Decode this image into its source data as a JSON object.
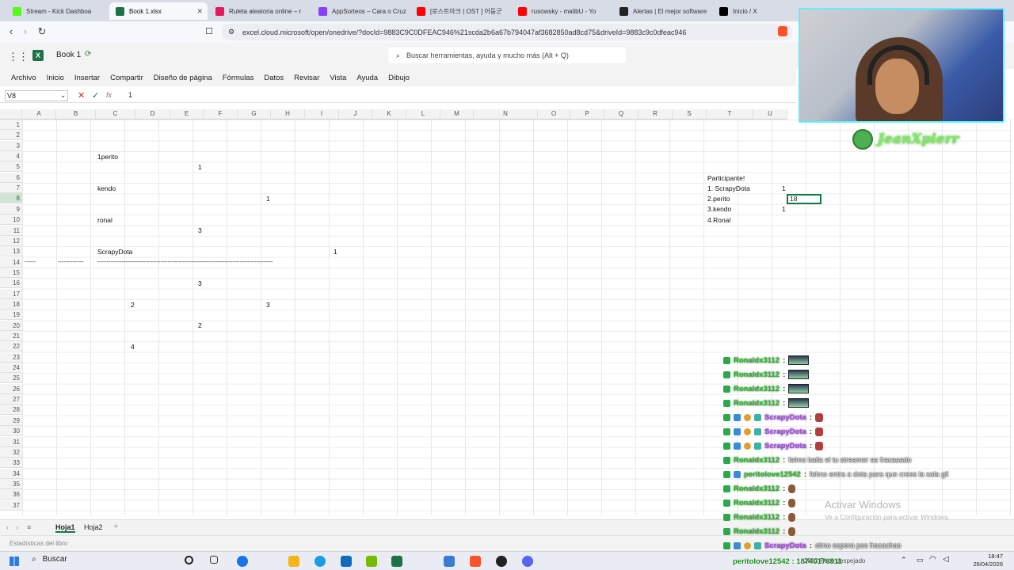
{
  "browser": {
    "tabs": [
      {
        "label": "Stream - Kick Dashboa",
        "color": "#53fc18"
      },
      {
        "label": "Book 1.xlsx",
        "color": "#1e7145",
        "active": true
      },
      {
        "label": "Ruleta aleatoria online – r",
        "color": "#e5195b"
      },
      {
        "label": "AppSorteos – Cara o Cruz",
        "color": "#8a3ffc"
      },
      {
        "label": "[로스트아크 | OST ] 어둠군",
        "color": "#ff0000"
      },
      {
        "label": "rusowsky - malibU - Yo",
        "color": "#ff0000"
      },
      {
        "label": "Alertas | El mejor software",
        "color": "#222222"
      },
      {
        "label": "Inicio / X",
        "color": "#000000"
      }
    ],
    "close_label": "✕",
    "url": "excel.cloud.microsoft/open/onedrive/?docId=9883C9C0DFEAC946%21scda2b6a67b794047af3682850ad8cd75&driveId=9883c9c0dfeac946"
  },
  "excel": {
    "book_title": "Book 1",
    "search_placeholder": "Buscar herramientas, ayuda y mucho más (Alt + Q)",
    "ribbon_tabs": [
      "Archivo",
      "Inicio",
      "Insertar",
      "Compartir",
      "Diseño de página",
      "Fórmulas",
      "Datos",
      "Revisar",
      "Vista",
      "Ayuda",
      "Dibujo"
    ],
    "name_box": "V8",
    "formula_value": "1",
    "fx": "fx",
    "columns": [
      "A",
      "B",
      "C",
      "D",
      "E",
      "F",
      "G",
      "H",
      "I",
      "J",
      "K",
      "L",
      "M",
      "N",
      "O",
      "P",
      "Q",
      "R",
      "S",
      "T",
      "U"
    ],
    "rows": [
      "1",
      "2",
      "3",
      "4",
      "5",
      "6",
      "7",
      "8",
      "9",
      "10",
      "11",
      "12",
      "13",
      "14",
      "15",
      "16",
      "17",
      "18",
      "19",
      "20",
      "21",
      "22",
      "23",
      "24",
      "25",
      "26",
      "27",
      "28",
      "29",
      "30",
      "31",
      "32",
      "33",
      "34",
      "35",
      "36",
      "37"
    ],
    "cells": {
      "c4": "1perito",
      "e5": "1",
      "c7": "kendo",
      "g8": "1",
      "c10": "ronal",
      "e11": "3",
      "c13": "ScrapyDota",
      "i13": "1",
      "a14": "------",
      "b14": "--------------",
      "c14": "-----------------------------------------------------------------------------------------------",
      "e16": "3",
      "d18": "2",
      "g18": "3",
      "e20": "2",
      "d22": "4",
      "t6": "Participante!",
      "t7": "1. ScrapyDota",
      "u7": "1",
      "t8": "2.perito",
      "t9": "3.kendo",
      "u9": "1",
      "t10": "4.Ronal"
    },
    "editing_value": "18",
    "sheets": [
      "Hoja1",
      "Hoja2"
    ],
    "add_sheet": "+",
    "status": "Estadísticas del libro"
  },
  "stream": {
    "streamer_name": "JeanXpierr",
    "chat": [
      {
        "user": "Ronaldx3112",
        "type": "emote"
      },
      {
        "user": "Ronaldx3112",
        "type": "emote"
      },
      {
        "user": "Ronaldx3112",
        "type": "emote"
      },
      {
        "user": "Ronaldx3112",
        "type": "emote"
      },
      {
        "user": "ScrapyDota",
        "type": "small",
        "purple": true
      },
      {
        "user": "ScrapyDota",
        "type": "small",
        "purple": true
      },
      {
        "user": "ScrapyDota",
        "type": "small",
        "purple": true
      },
      {
        "user": "Ronaldx3112",
        "type": "text",
        "text": "felmo baila el tu streamer es fracasado"
      },
      {
        "user": "peritolove12542",
        "type": "text",
        "text": "felmo entra a dota para que crees la sala gil"
      },
      {
        "user": "Ronaldx3112",
        "type": "guy"
      },
      {
        "user": "Ronaldx3112",
        "type": "guy"
      },
      {
        "user": "Ronaldx3112",
        "type": "guy"
      },
      {
        "user": "Ronaldx3112",
        "type": "guy"
      },
      {
        "user": "ScrapyDota",
        "type": "text",
        "text": "elmo espera pes fracachao",
        "purple": true
      }
    ],
    "tray_message": "peritolove12542 : 18740176511"
  },
  "windows": {
    "watermark_title": "Activar Windows",
    "watermark_sub": "Ve a Configuración para activar Windows.",
    "search_label": "Buscar",
    "weather": "28°C Poco despejado",
    "time": "18:47",
    "date": "26/04/2026"
  }
}
